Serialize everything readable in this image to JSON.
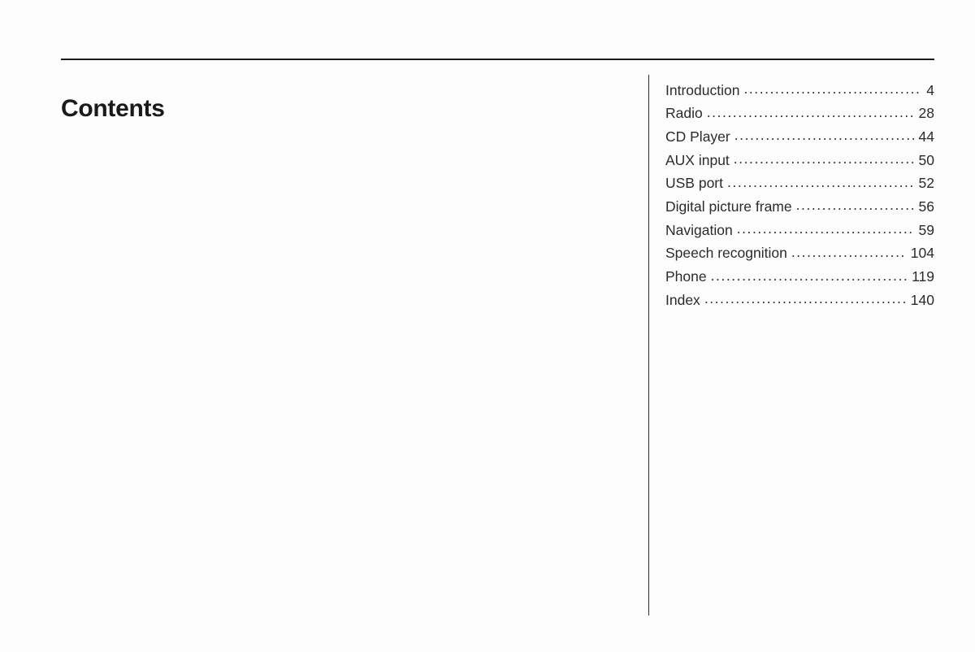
{
  "document": {
    "title": "Contents"
  },
  "toc": {
    "entries": [
      {
        "label": "Introduction",
        "page": "4"
      },
      {
        "label": "Radio",
        "page": "28"
      },
      {
        "label": "CD Player",
        "page": "44"
      },
      {
        "label": "AUX input",
        "page": "50"
      },
      {
        "label": "USB port",
        "page": "52"
      },
      {
        "label": "Digital picture frame",
        "page": "56"
      },
      {
        "label": "Navigation",
        "page": "59"
      },
      {
        "label": "Speech recognition",
        "page": "104"
      },
      {
        "label": "Phone",
        "page": "119"
      },
      {
        "label": "Index",
        "page": "140"
      }
    ]
  },
  "colors": {
    "text": "#2b2b2b",
    "heading": "#1a1a1a",
    "rule": "#1c1c1c",
    "background": "#fdfdfd"
  }
}
